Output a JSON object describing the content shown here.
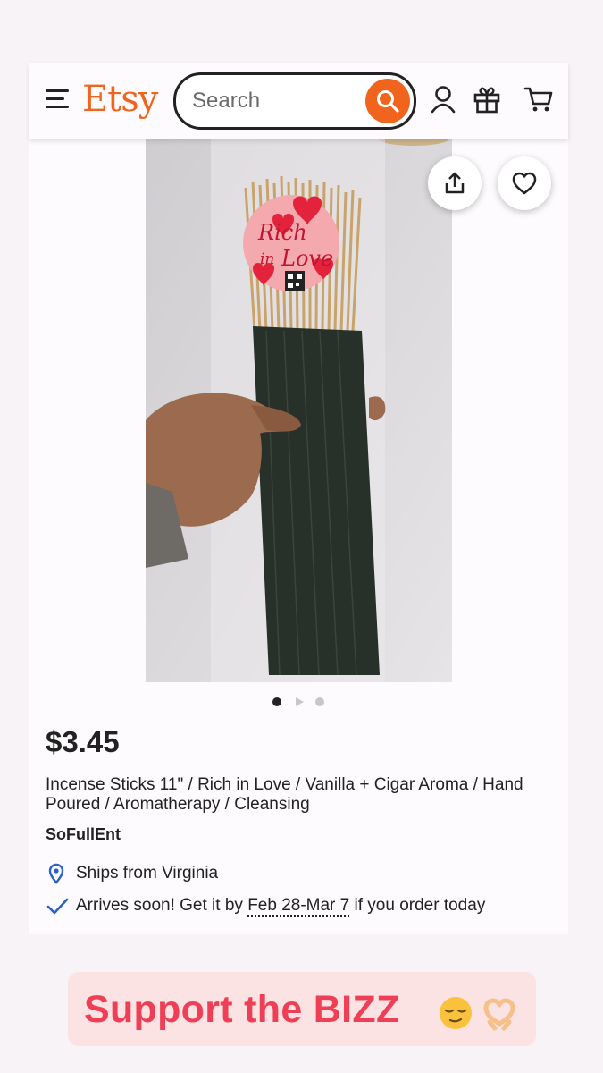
{
  "header": {
    "logo": "Etsy",
    "search_placeholder": "Search",
    "icons": [
      "menu-icon",
      "search-icon",
      "account-icon",
      "gift-icon",
      "cart-icon"
    ]
  },
  "product": {
    "image_actions": [
      "share-icon",
      "favorite-heart-icon"
    ],
    "image_count": 3,
    "active_image": 1,
    "price": "$3.45",
    "title": "Incense Sticks 11\" / Rich in Love / Vanilla + Cigar Aroma / Hand Poured / Aromatherapy / Cleansing",
    "shop_name": "SoFullEnt",
    "ships_from": "Ships from Virginia",
    "arrival_prefix": "Arrives soon! Get it by ",
    "arrival_dates": "Feb 28-Mar 7",
    "arrival_suffix": " if you order today",
    "sticker_text": "Rich in Love"
  },
  "story_caption": {
    "text": "Support the BIZZ",
    "emojis": [
      "relieved-face-icon",
      "heart-hands-icon"
    ]
  },
  "colors": {
    "brand_orange": "#f1641e",
    "caption_red": "#ef3f56",
    "caption_bg": "#fbe2e3",
    "check_blue": "#2b61c9"
  }
}
